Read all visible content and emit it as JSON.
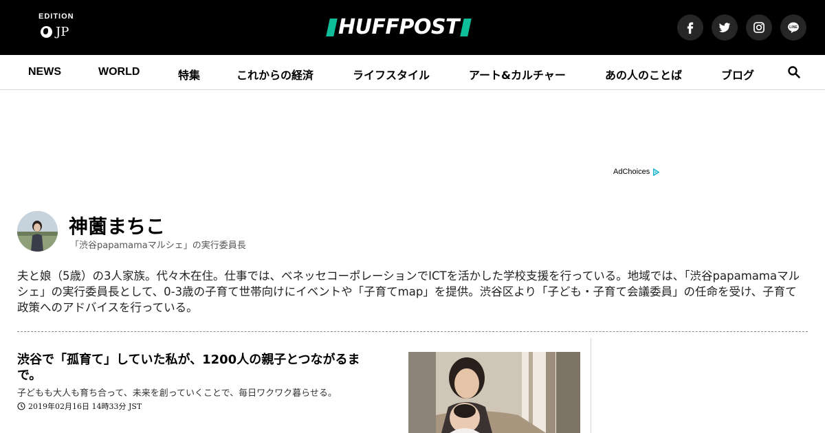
{
  "header": {
    "edition_label": "EDITION",
    "edition_code": "JP",
    "logo_text": "HUFFPOST",
    "brand_color": "#0dbe98",
    "social": [
      {
        "name": "facebook-icon"
      },
      {
        "name": "twitter-icon"
      },
      {
        "name": "instagram-icon"
      },
      {
        "name": "line-icon",
        "label": "LINE"
      }
    ]
  },
  "nav": {
    "items": [
      "NEWS",
      "WORLD",
      "特集",
      "これからの経済",
      "ライフスタイル",
      "アート&カルチャー",
      "あの人のことば",
      "ブログ"
    ],
    "search_icon": "search-icon"
  },
  "ad": {
    "adchoices_label": "AdChoices"
  },
  "author": {
    "name": "神薗まちこ",
    "title": "「渋谷papamamaマルシェ」の実行委員長",
    "bio": "夫と娘（5歳）の3人家族。代々木在住。仕事では、ベネッセコーポレーションでICTを活かした学校支援を行っている。地域では、「渋谷papamamaマルシェ」の実行委員長として、0-3歳の子育て世帯向けにイベントや「子育てmap」を提供。渋谷区より「子ども・子育て会議委員」の任命を受け、子育て政策へのアドバイスを行っている。"
  },
  "article": {
    "title": "渋谷で「孤育て」していた私が、1200人の親子とつながるまで。",
    "description": "子どもも大人も育ち合って、未来を創っていくことで、毎日ワクワク暮らせる。",
    "timestamp": "2019年02月16日 14時33分 JST"
  }
}
